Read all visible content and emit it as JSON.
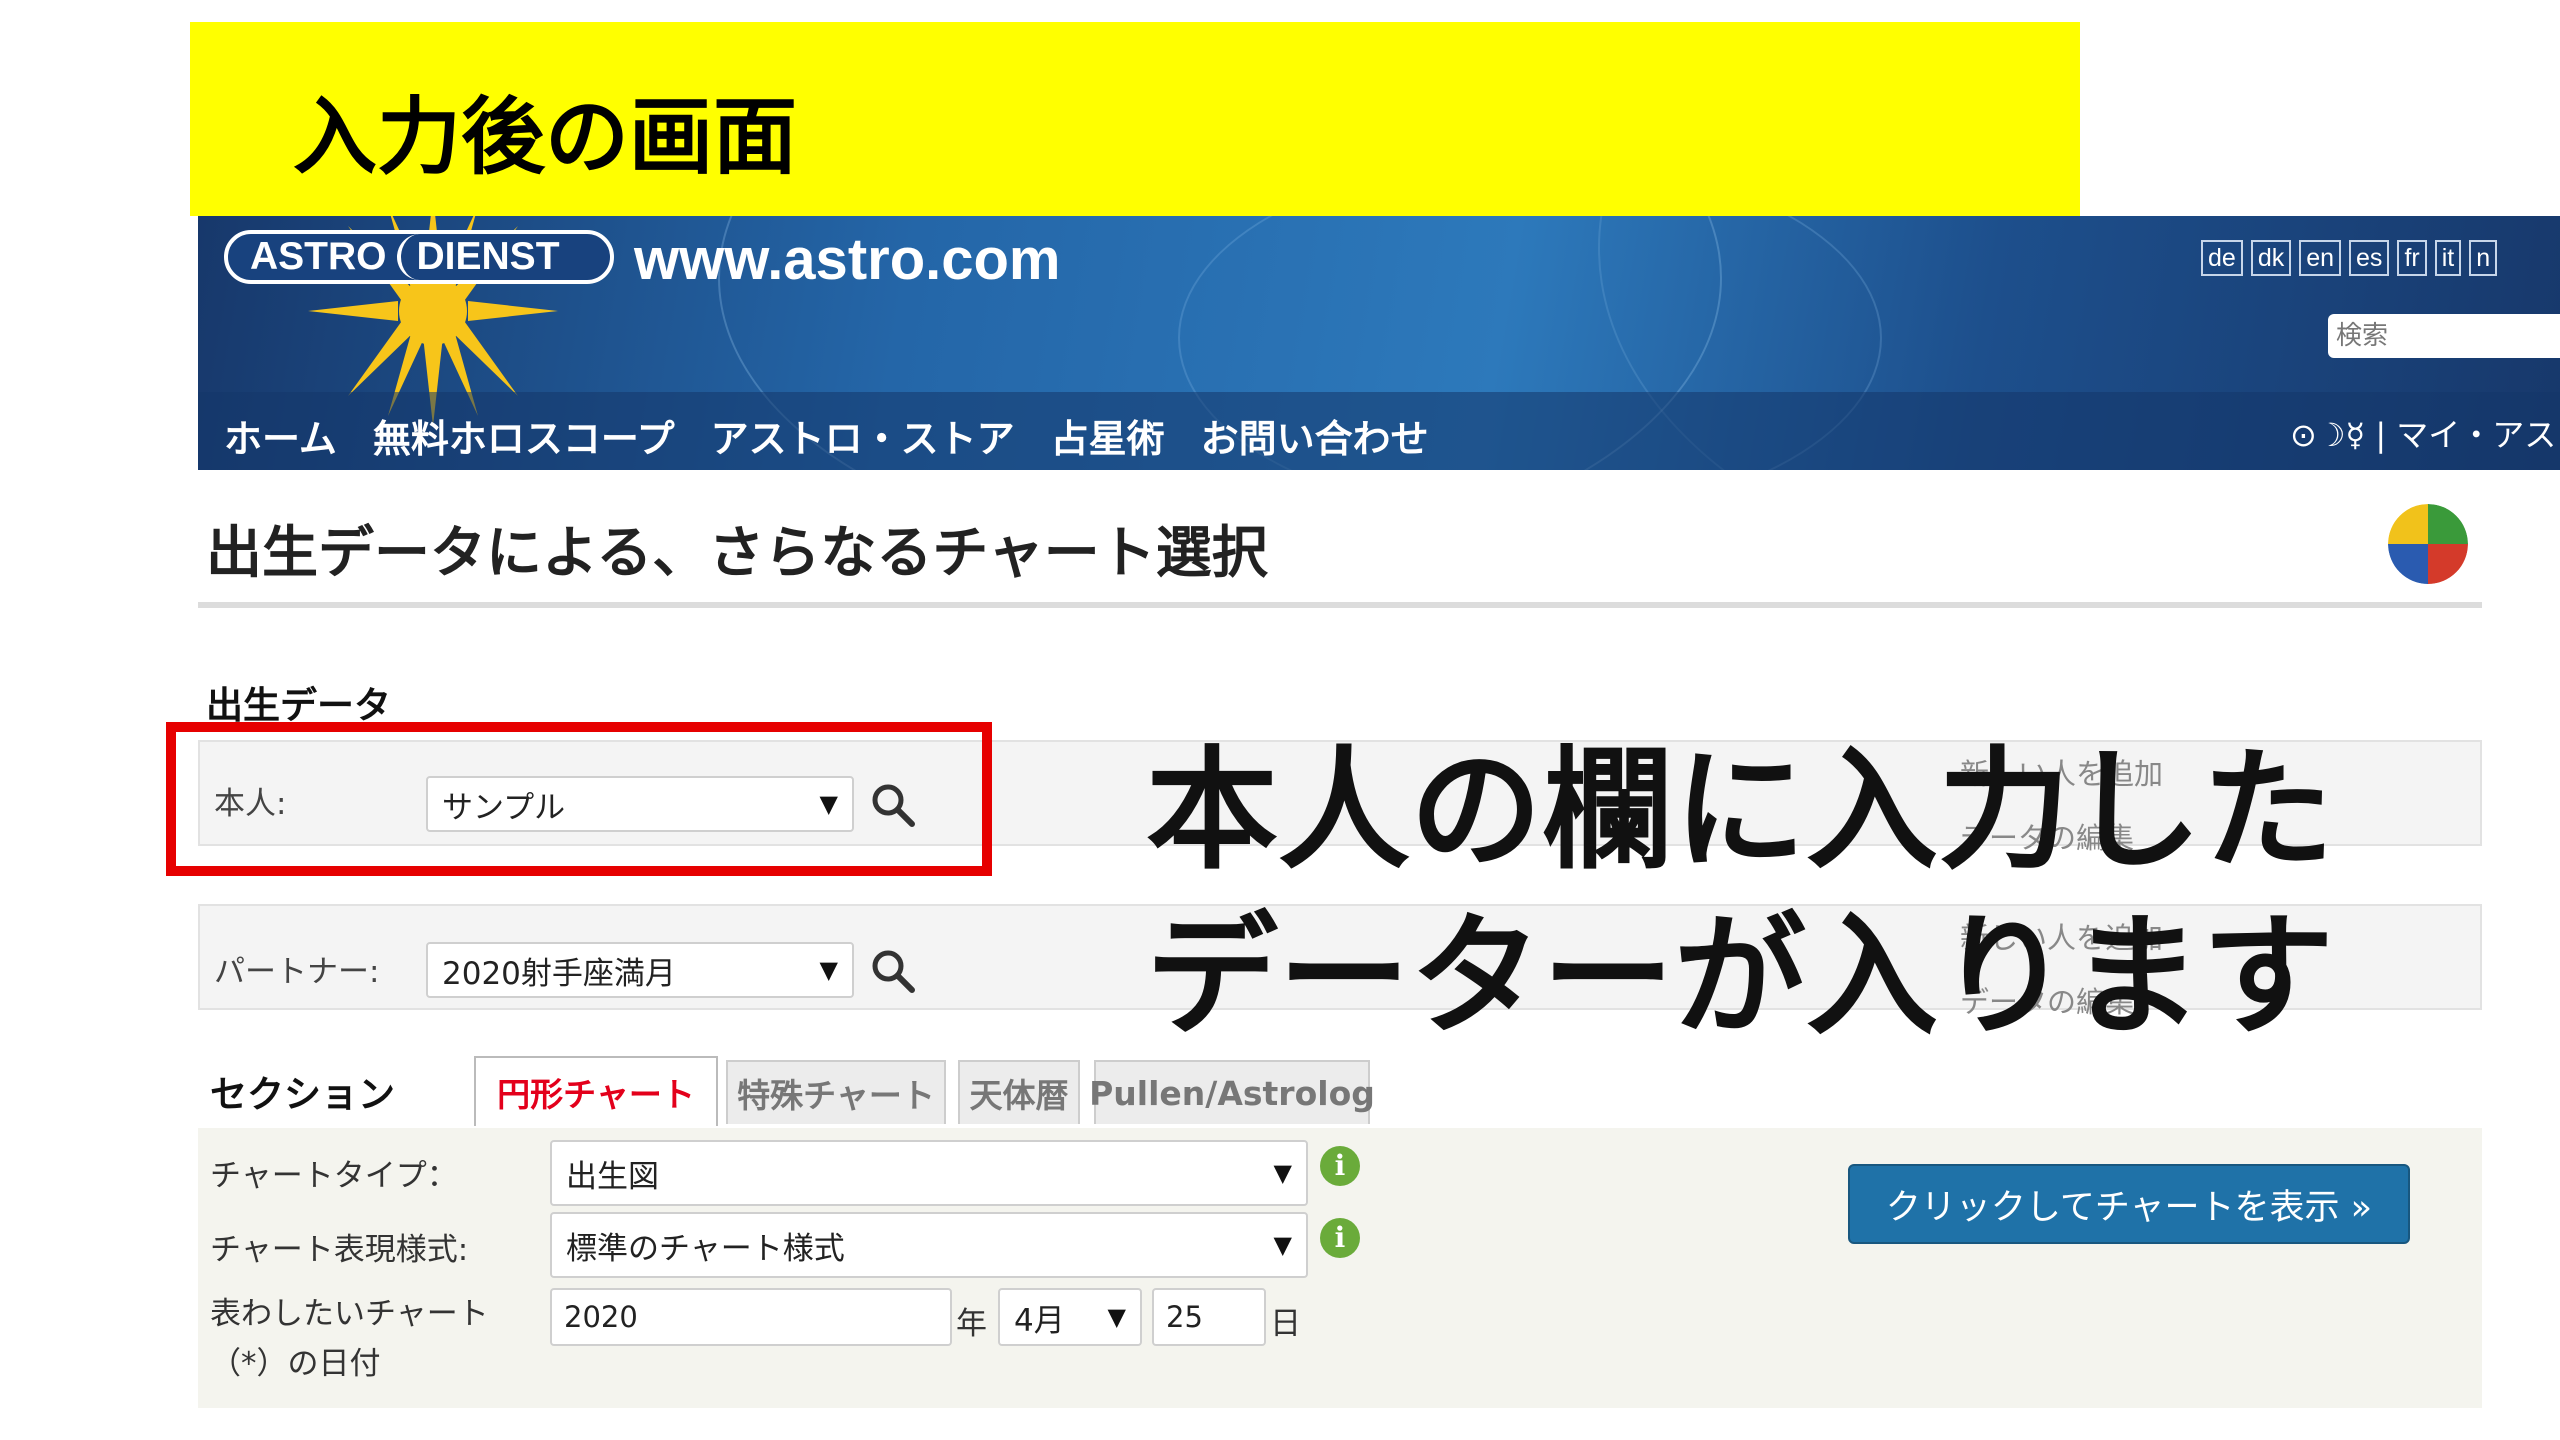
{
  "banner": {
    "title": "入力後の画面"
  },
  "header": {
    "logo_left": "ASTRO",
    "logo_right": "DIENST",
    "site_url": "www.astro.com",
    "languages": [
      "de",
      "dk",
      "en",
      "es",
      "fr",
      "it",
      "n"
    ],
    "search_placeholder": "検索",
    "nav": [
      "ホーム",
      "無料ホロスコープ",
      "アストロ・ストア",
      "占星術",
      "お問い合わせ"
    ],
    "my_astro": "⊙☽☿ | マイ・アス"
  },
  "page": {
    "title": "出生データによる、さらなるチャート選択"
  },
  "birth_data": {
    "heading": "出生データ",
    "self": {
      "label": "本人:",
      "value": "サンプル",
      "add_link": "新しい人を追加",
      "edit_link": "データの編集"
    },
    "partner": {
      "label": "パートナー:",
      "value": "2020射手座満月",
      "add_link": "新しい人を追加",
      "edit_link": "データの編集"
    }
  },
  "annotation": {
    "line1": "本人の欄に入力した",
    "line2": "データーが入ります"
  },
  "section": {
    "label": "セクション",
    "tabs": [
      "円形チャート",
      "特殊チャート",
      "天体暦",
      "Pullen/Astrolog"
    ]
  },
  "form": {
    "chart_type_label": "チャートタイプ：",
    "chart_type_value": "出生図",
    "chart_style_label": "チャート表現様式:",
    "chart_style_value": "標準のチャート様式",
    "date_label_1": "表わしたいチャート",
    "date_label_2": "（*）の日付",
    "year": "2020",
    "year_unit": "年",
    "month": "4月",
    "day": "25",
    "day_unit": "日",
    "submit": "クリックしてチャートを表示 »"
  },
  "colors": {
    "banner": "#ffff00",
    "highlight": "#e60000",
    "active_tab": "#e3001b",
    "button": "#1f72a8",
    "info": "#6aab3a"
  }
}
